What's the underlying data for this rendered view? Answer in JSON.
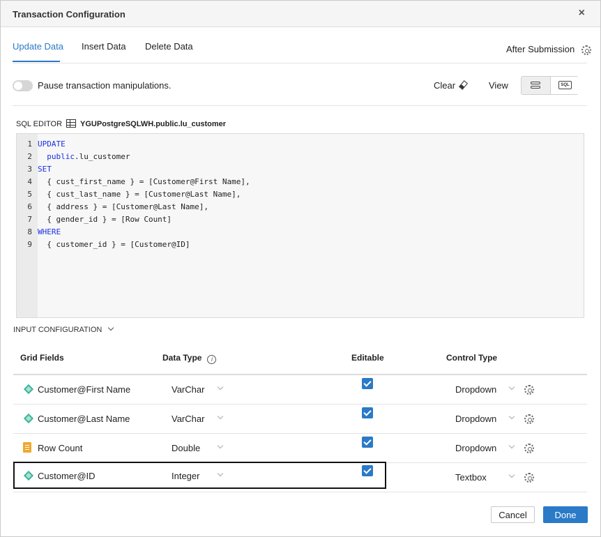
{
  "dialog": {
    "title": "Transaction Configuration",
    "close_label": "×"
  },
  "tabs": [
    {
      "label": "Update Data",
      "active": true
    },
    {
      "label": "Insert Data",
      "active": false
    },
    {
      "label": "Delete Data",
      "active": false
    }
  ],
  "after_submission": {
    "label": "After Submission",
    "icon": "gear-icon"
  },
  "toggle": {
    "label": "Pause transaction manipulations.",
    "on": false
  },
  "toolbar": {
    "clear_label": "Clear",
    "clear_icon": "eraser-icon",
    "view_label": "View",
    "view_options": [
      {
        "name": "visual-view-icon",
        "selected": false
      },
      {
        "name": "sql-view-icon",
        "label": "SQL",
        "selected": true
      }
    ]
  },
  "sql_editor": {
    "label": "SQL EDITOR",
    "source_icon": "table-icon",
    "source": "YGUPostgreSQLWH.public.lu_customer",
    "lines": [
      {
        "n": "1",
        "text": "UPDATE",
        "keyword": true
      },
      {
        "n": "2",
        "text": "  public.lu_customer",
        "keyword": false
      },
      {
        "n": "3",
        "text": "SET",
        "keyword": true
      },
      {
        "n": "4",
        "text": "  { cust_first_name } = [Customer@First Name],",
        "keyword": false
      },
      {
        "n": "5",
        "text": "  { cust_last_name } = [Customer@Last Name],",
        "keyword": false
      },
      {
        "n": "6",
        "text": "  { address } = [Customer@Last Name],",
        "keyword": false
      },
      {
        "n": "7",
        "text": "  { gender_id } = [Row Count]",
        "keyword": false
      },
      {
        "n": "8",
        "text": "WHERE",
        "keyword": true
      },
      {
        "n": "9",
        "text": "  { customer_id } = [Customer@ID]",
        "keyword": false
      }
    ]
  },
  "input_configuration": {
    "label": "INPUT CONFIGURATION",
    "columns": {
      "grid_fields": "Grid Fields",
      "data_type": "Data Type",
      "editable": "Editable",
      "control_type": "Control Type"
    },
    "rows": [
      {
        "icon": "attribute-icon",
        "field": "Customer@First Name",
        "data_type": "VarChar",
        "editable": true,
        "control_type": "Dropdown"
      },
      {
        "icon": "attribute-icon",
        "field": "Customer@Last Name",
        "data_type": "VarChar",
        "editable": true,
        "control_type": "Dropdown"
      },
      {
        "icon": "metric-icon",
        "field": "Row Count",
        "data_type": "Double",
        "editable": true,
        "control_type": "Dropdown"
      },
      {
        "icon": "attribute-icon",
        "field": "Customer@ID",
        "data_type": "Integer",
        "editable": true,
        "control_type": "Textbox",
        "selected": true
      }
    ]
  },
  "footer": {
    "cancel_label": "Cancel",
    "done_label": "Done"
  },
  "colors": {
    "accent": "#2a7ac7",
    "keyword": "#1a2fe0",
    "attribute": "#3cb59a",
    "metric": "#f0a830"
  }
}
